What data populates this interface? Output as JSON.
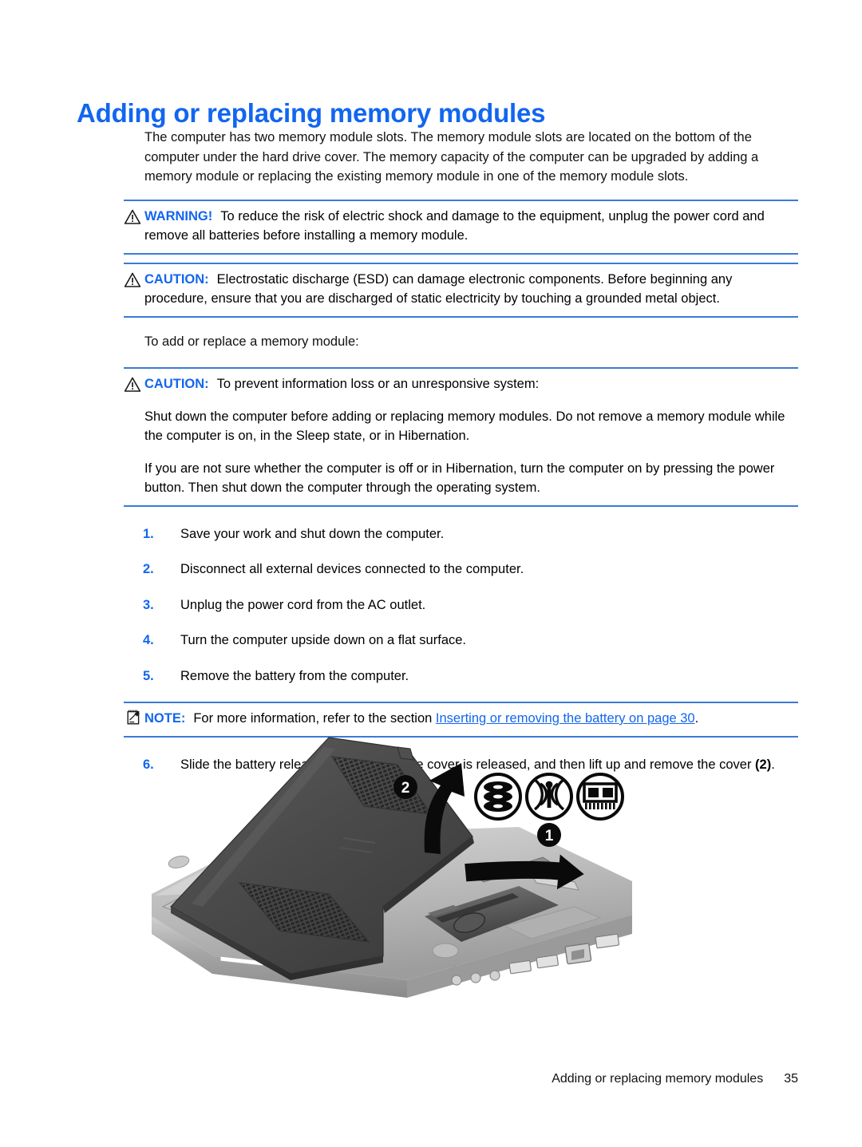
{
  "document": {
    "title": "Adding or replacing memory modules",
    "intro": "The computer has two memory module slots. The memory module slots are located on the bottom of the computer under the hard drive cover. The memory capacity of the computer can be upgraded by adding a memory module or replacing the existing memory module in one of the memory module slots.",
    "lead_in": "To add or replace a memory module:"
  },
  "warning": {
    "label": "WARNING!",
    "icon": "warning-triangle-icon",
    "text": "To reduce the risk of electric shock and damage to the equipment, unplug the power cord and remove all batteries before installing a memory module."
  },
  "caution_esd": {
    "label": "CAUTION:",
    "icon": "warning-triangle-icon",
    "text": "Electrostatic discharge (ESD) can damage electronic components. Before beginning any procedure, ensure that you are discharged of static electricity by touching a grounded metal object."
  },
  "caution_data": {
    "label": "CAUTION:",
    "icon": "warning-triangle-icon",
    "text": "To prevent information loss or an unresponsive system:",
    "paragraph_1": "Shut down the computer before adding or replacing memory modules. Do not remove a memory module while the computer is on, in the Sleep state, or in Hibernation.",
    "paragraph_2": "If you are not sure whether the computer is off or in Hibernation, turn the computer on by pressing the power button. Then shut down the computer through the operating system."
  },
  "steps": [
    {
      "number": "1.",
      "text": "Save your work and shut down the computer."
    },
    {
      "number": "2.",
      "text": "Disconnect all external devices connected to the computer."
    },
    {
      "number": "3.",
      "text": "Unplug the power cord from the AC outlet."
    },
    {
      "number": "4.",
      "text": "Turn the computer upside down on a flat surface."
    },
    {
      "number": "5.",
      "text": "Remove the battery from the computer."
    }
  ],
  "note": {
    "label": "NOTE:",
    "icon": "notepad-pencil-icon",
    "text_before": "For more information, refer to the section",
    "link_text": "Inserting or removing the battery on page 30",
    "text_after": "."
  },
  "step_six": {
    "number": "6.",
    "part_1": "Slide the battery release latch",
    "callout_1": "(1)",
    "part_2": "until the cover is released, and then lift up and remove the cover",
    "callout_2": "(2)",
    "part_3": "."
  },
  "figure": {
    "alt": "Bottom view of laptop with service cover being lifted off",
    "callouts": [
      {
        "id": "1",
        "meaning": "battery release latch"
      },
      {
        "id": "2",
        "meaning": "lift and remove cover"
      }
    ],
    "compartment_icons": [
      "hard-drive-icon",
      "wireless-antenna-icon",
      "memory-module-icon"
    ]
  },
  "footer": {
    "section_title": "Adding or replacing memory modules",
    "page_number": "35"
  },
  "colors": {
    "accent_blue": "#1266ef",
    "rule_blue": "#3c7ad6",
    "text_black": "#111111"
  }
}
